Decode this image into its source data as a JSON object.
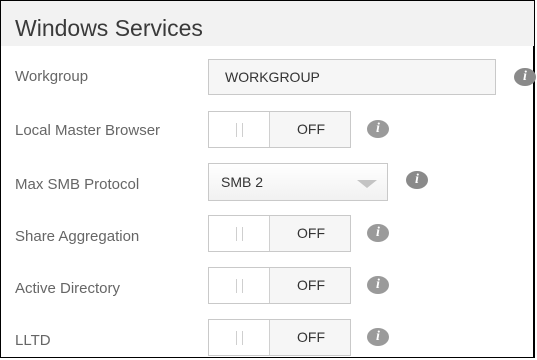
{
  "header": {
    "title": "Windows Services"
  },
  "rows": [
    {
      "label": "Workgroup",
      "type": "text",
      "value": "WORKGROUP"
    },
    {
      "label": "Local Master Browser",
      "type": "toggle",
      "state": "OFF"
    },
    {
      "label": "Max SMB Protocol",
      "type": "select",
      "value": "SMB 2"
    },
    {
      "label": "Share Aggregation",
      "type": "toggle",
      "state": "OFF"
    },
    {
      "label": "Active Directory",
      "type": "toggle",
      "state": "OFF"
    },
    {
      "label": "LLTD",
      "type": "toggle",
      "state": "OFF"
    }
  ],
  "icons": {
    "info": {
      "name": "info-icon",
      "glyph": "i"
    },
    "select_arrow": "chevron-down-icon"
  },
  "colors": {
    "header_bg": "#f2f2f2",
    "info_icon": "#8a8a8a",
    "control_border": "#c9c9c9",
    "label_text": "#666666"
  }
}
